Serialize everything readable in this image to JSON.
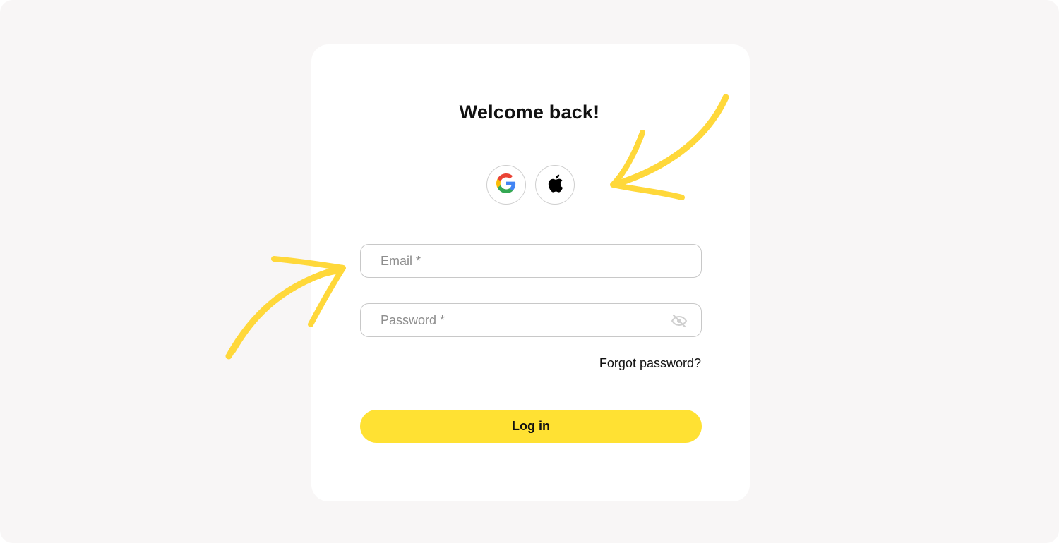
{
  "header": {
    "title": "Welcome back!"
  },
  "social_login": [
    {
      "provider": "Google",
      "icon": "google-icon"
    },
    {
      "provider": "Apple",
      "icon": "apple-icon"
    }
  ],
  "form": {
    "email": {
      "placeholder": "Email *",
      "value": ""
    },
    "password": {
      "placeholder": "Password *",
      "value": "",
      "toggle_icon": "eye-off-icon"
    },
    "forgot_link": "Forgot password?",
    "submit_label": "Log in"
  },
  "colors": {
    "background": "#f8f6f6",
    "card": "#ffffff",
    "accent": "#ffe133",
    "annotation_arrows": "#ffd83a",
    "field_border": "#c8c8c8"
  }
}
